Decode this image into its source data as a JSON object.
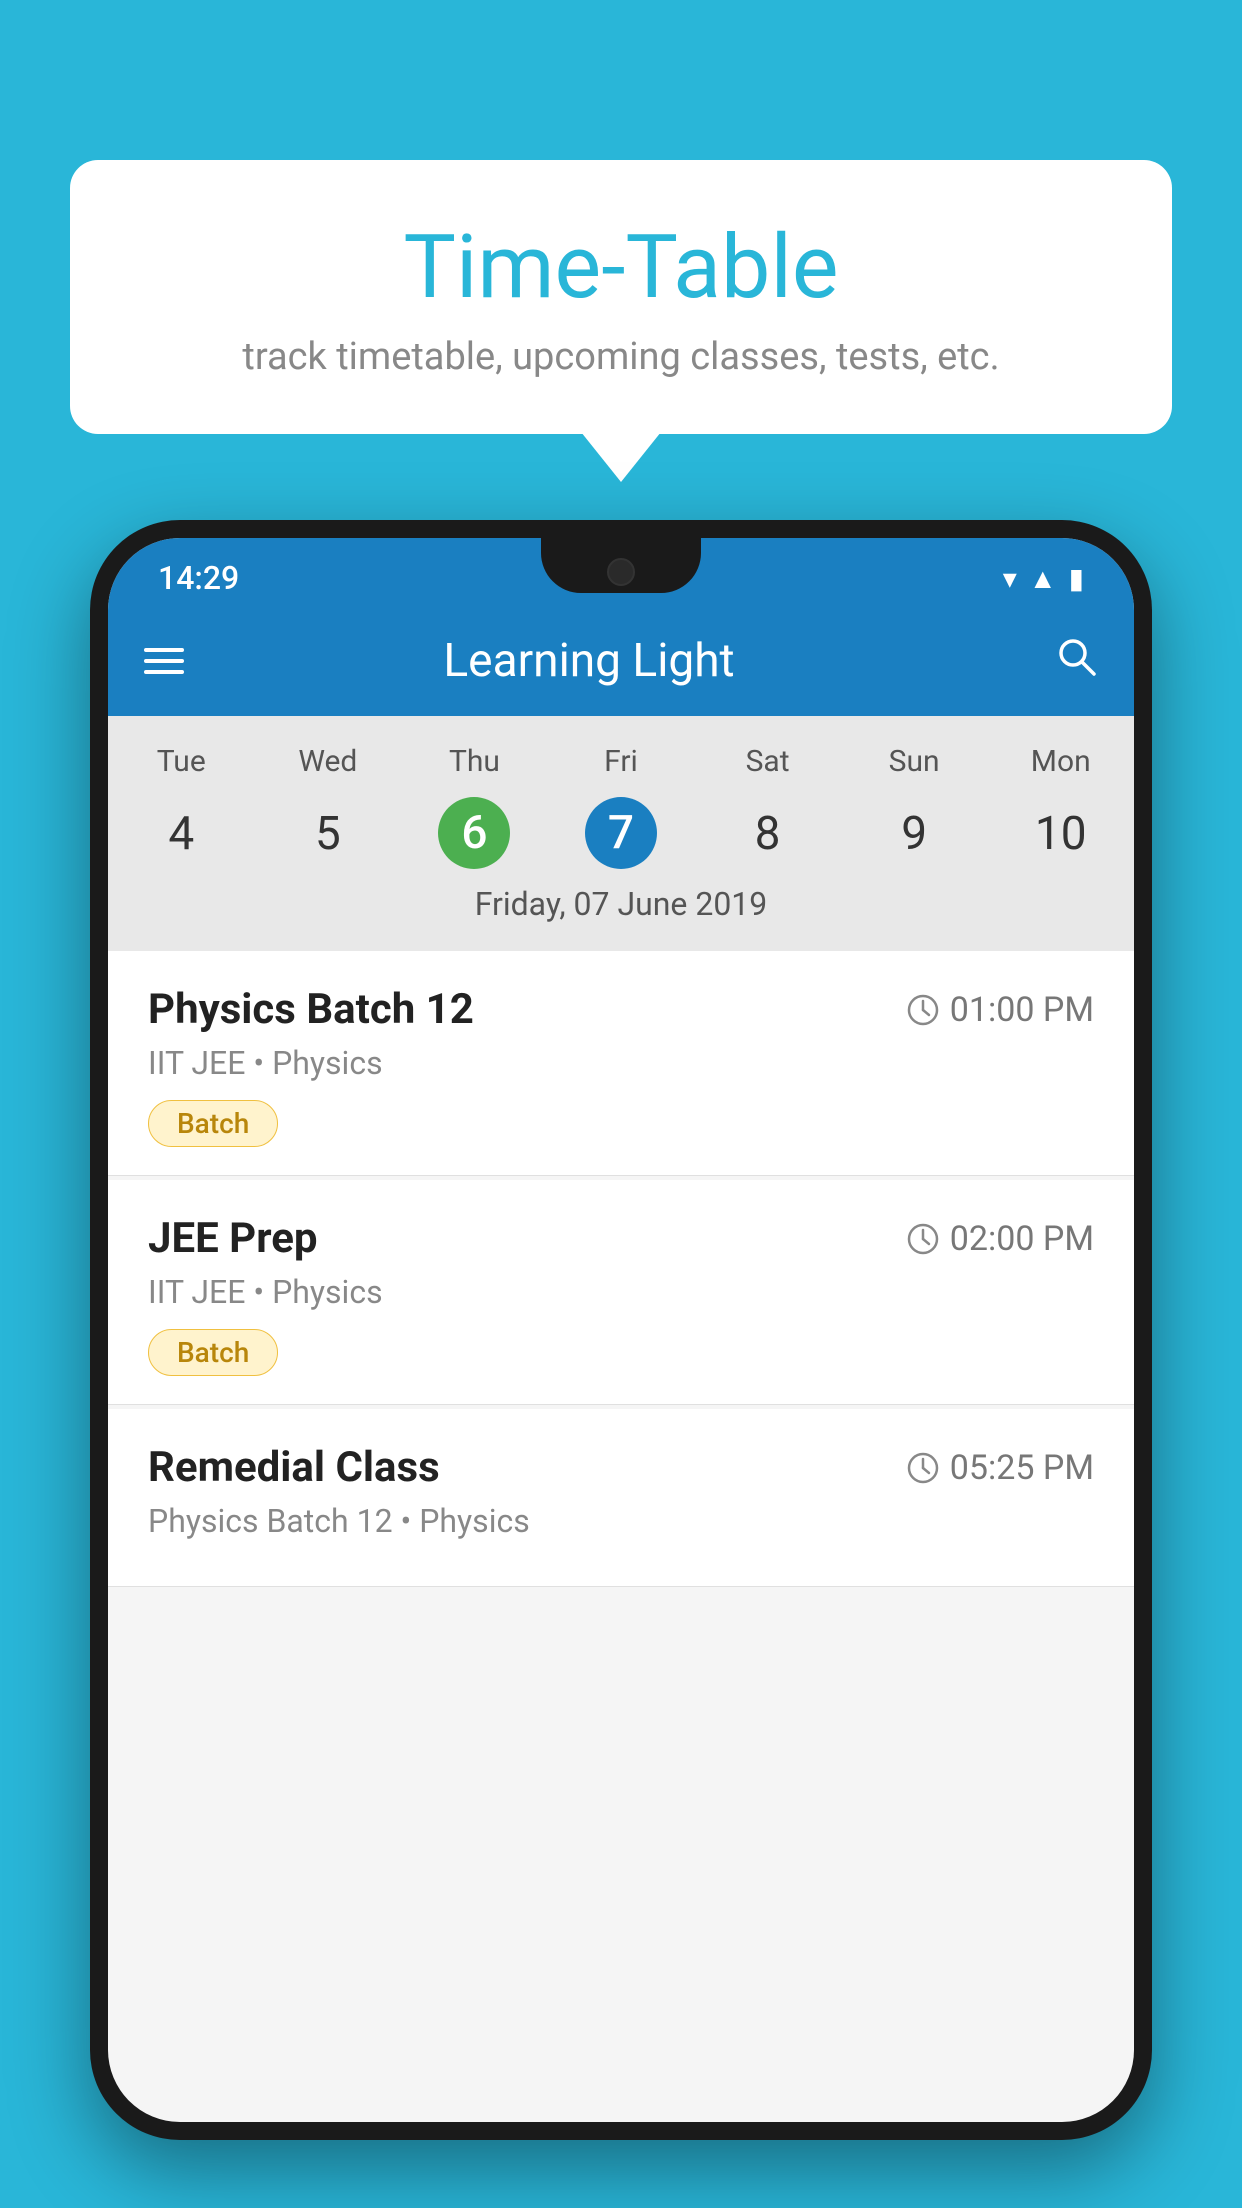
{
  "background": {
    "color": "#29b6d8"
  },
  "speech_bubble": {
    "title": "Time-Table",
    "subtitle": "track timetable, upcoming classes, tests, etc."
  },
  "phone": {
    "status_bar": {
      "time": "14:29"
    },
    "toolbar": {
      "title": "Learning Light",
      "menu_label": "menu",
      "search_label": "search"
    },
    "calendar": {
      "days": [
        {
          "label": "Tue",
          "num": "4"
        },
        {
          "label": "Wed",
          "num": "5"
        },
        {
          "label": "Thu",
          "num": "6",
          "state": "today"
        },
        {
          "label": "Fri",
          "num": "7",
          "state": "selected"
        },
        {
          "label": "Sat",
          "num": "8"
        },
        {
          "label": "Sun",
          "num": "9"
        },
        {
          "label": "Mon",
          "num": "10"
        }
      ],
      "selected_date_label": "Friday, 07 June 2019"
    },
    "schedule": [
      {
        "title": "Physics Batch 12",
        "time": "01:00 PM",
        "subtitle": "IIT JEE • Physics",
        "badge": "Batch"
      },
      {
        "title": "JEE Prep",
        "time": "02:00 PM",
        "subtitle": "IIT JEE • Physics",
        "badge": "Batch"
      },
      {
        "title": "Remedial Class",
        "time": "05:25 PM",
        "subtitle": "Physics Batch 12 • Physics",
        "badge": null
      }
    ]
  }
}
